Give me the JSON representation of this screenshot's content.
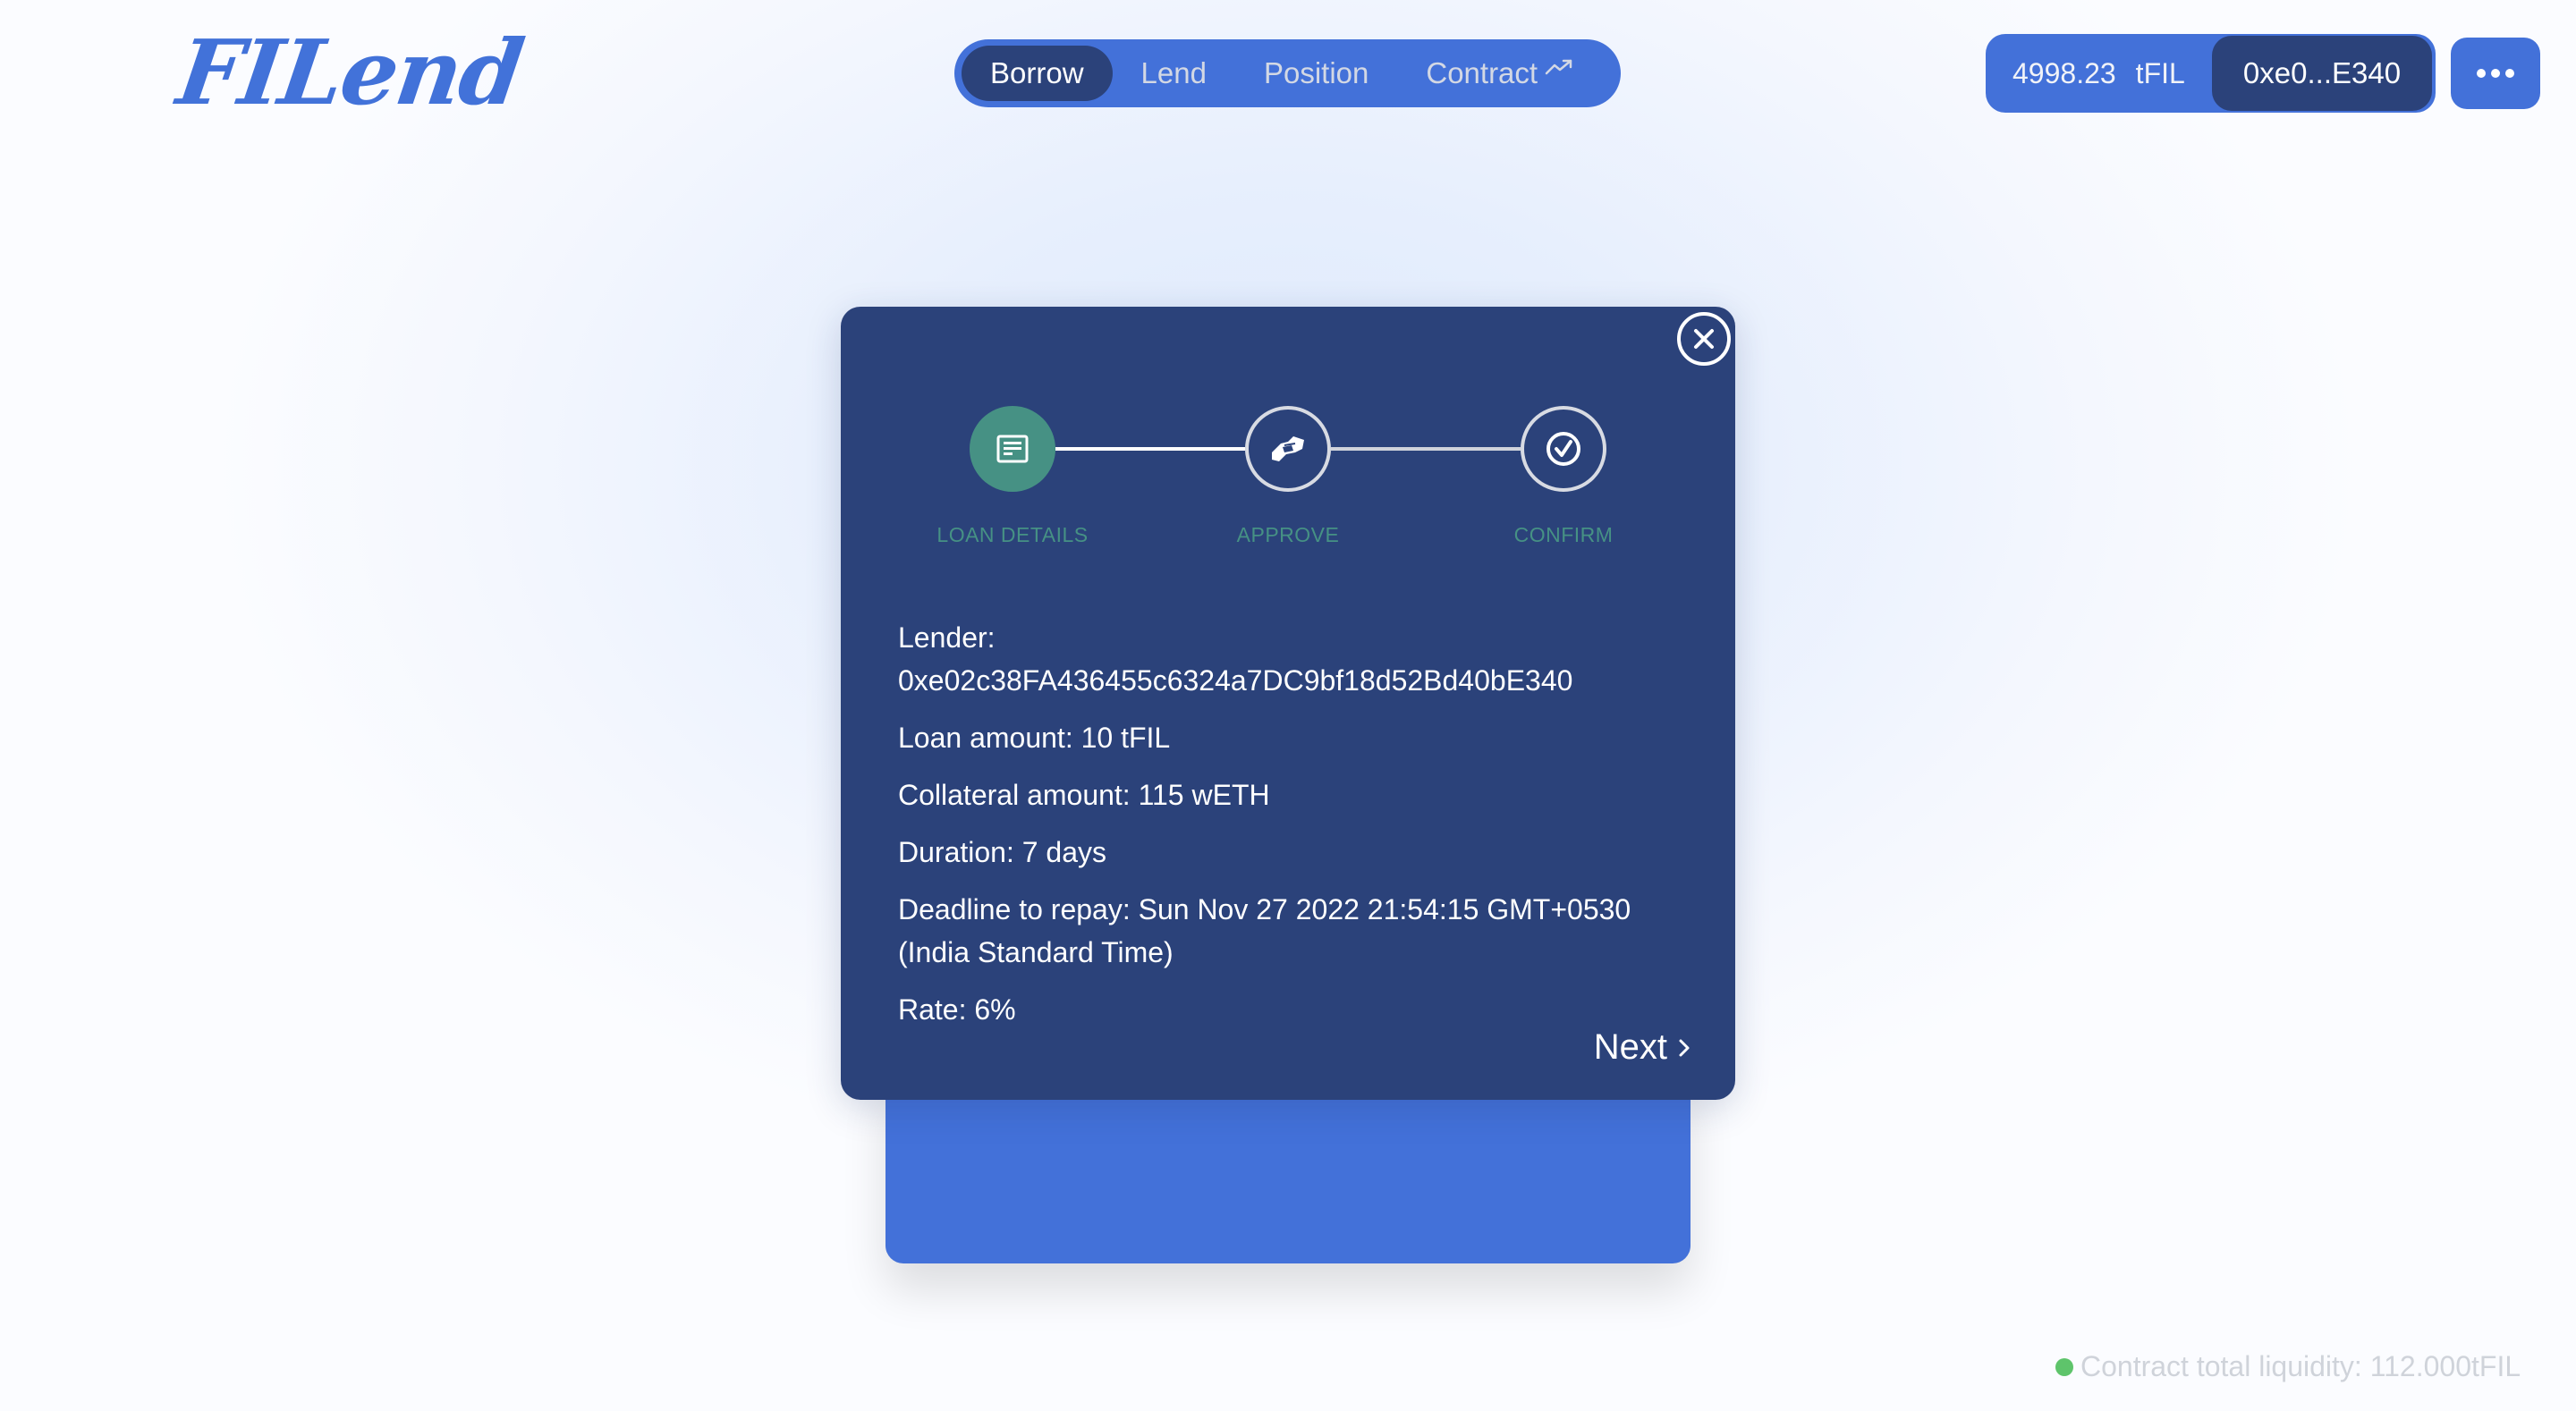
{
  "app": {
    "logo": "FILend"
  },
  "nav": {
    "items": [
      {
        "label": "Borrow",
        "active": true
      },
      {
        "label": "Lend",
        "active": false
      },
      {
        "label": "Position",
        "active": false
      },
      {
        "label": "Contract",
        "active": false,
        "icon": "trending-up-icon"
      }
    ]
  },
  "wallet": {
    "balance": "4998.23",
    "currency": "tFIL",
    "address": "0xe0...E340"
  },
  "menu": {
    "icon": "more-horizontal-icon"
  },
  "modal": {
    "steps": [
      {
        "label": "LOAN DETAILS",
        "icon": "document-icon",
        "status": "active"
      },
      {
        "label": "APPROVE",
        "icon": "handshake-icon",
        "status": "pending"
      },
      {
        "label": "CONFIRM",
        "icon": "check-circle-icon",
        "status": "pending"
      }
    ],
    "details": {
      "lender_label": "Lender:",
      "lender": "0xe02c38FA436455c6324a7DC9bf18d52Bd40bE340",
      "loan_amount": "Loan amount: 10 tFIL",
      "collateral_amount": "Collateral amount: 115 wETH",
      "duration": "Duration: 7 days",
      "deadline": "Deadline to repay: Sun Nov 27 2022 21:54:15 GMT+0530 (India Standard Time)",
      "rate": "Rate: 6%"
    },
    "next_label": "Next"
  },
  "footer": {
    "liquidity": "Contract total liquidity: 112.000tFIL"
  },
  "colors": {
    "brand_blue": "#4371d9",
    "dark_navy": "#2b427a",
    "step_green": "#469184",
    "status_green": "#5ec46b"
  }
}
